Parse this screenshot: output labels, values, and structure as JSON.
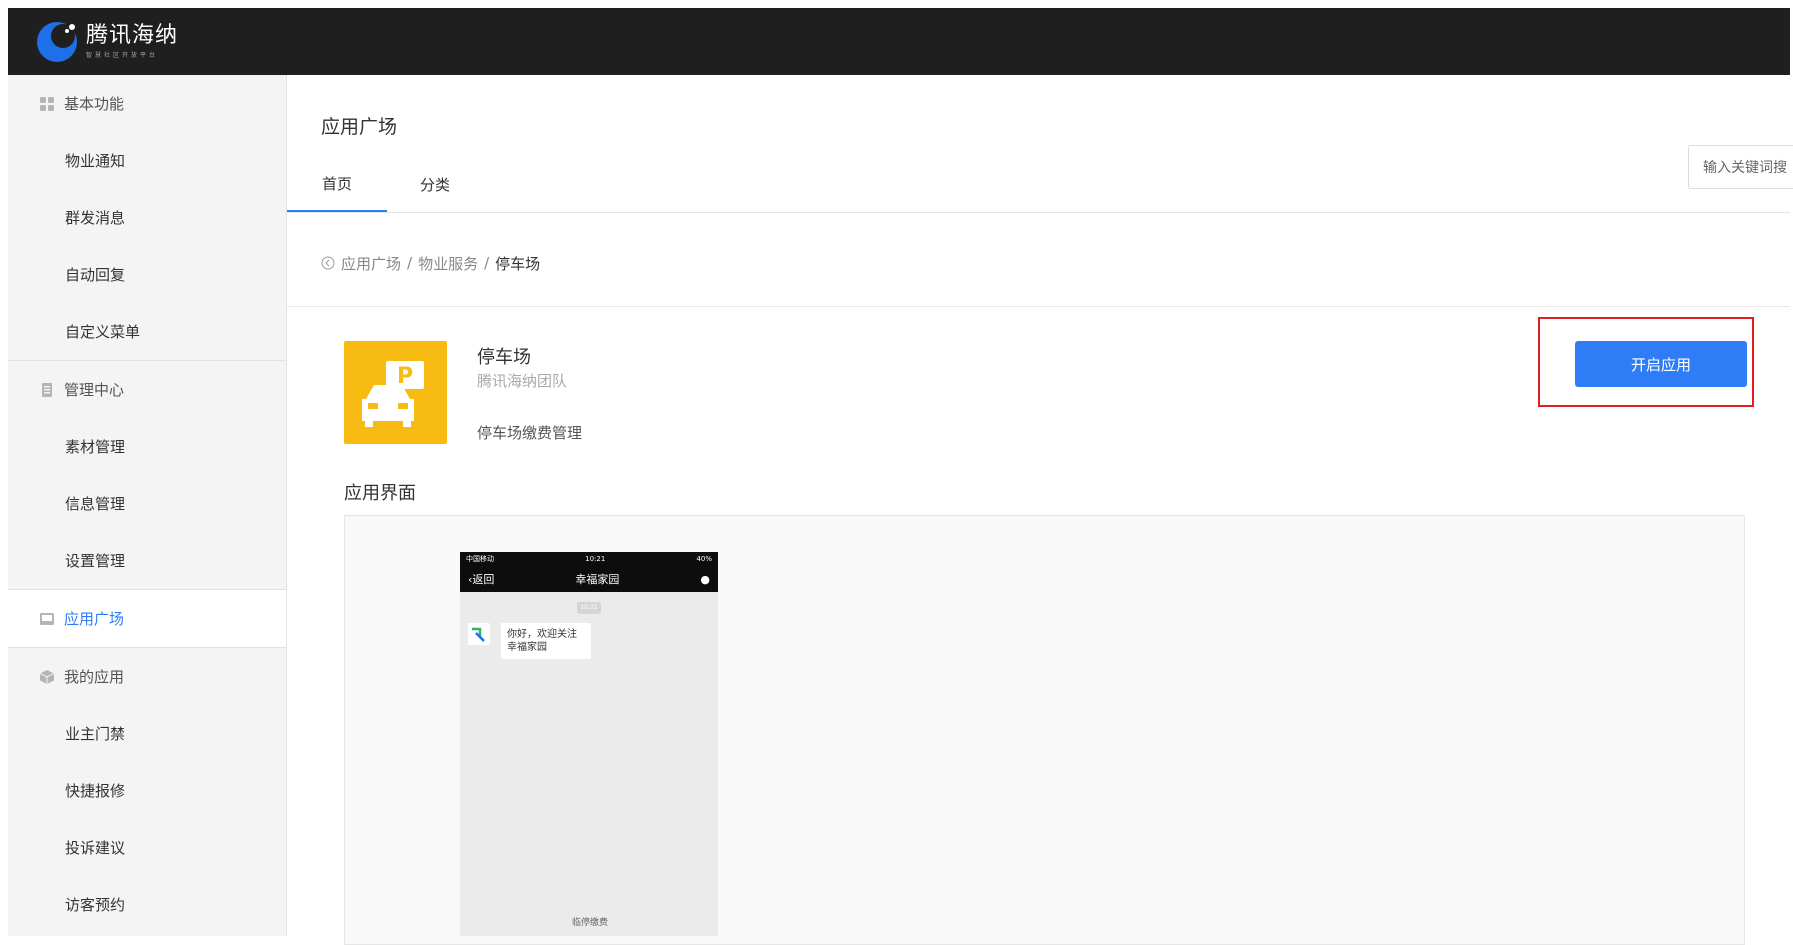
{
  "brand": {
    "name": "腾讯海纳",
    "tagline": "智慧社区开放平台"
  },
  "sidebar": {
    "groups": [
      {
        "title": "基本功能",
        "icon": "grid-icon",
        "items": [
          "物业通知",
          "群发消息",
          "自动回复",
          "自定义菜单"
        ]
      },
      {
        "title": "管理中心",
        "icon": "document-icon",
        "items": [
          "素材管理",
          "信息管理",
          "设置管理"
        ]
      },
      {
        "title": "应用广场",
        "icon": "app-store-icon",
        "active": true,
        "items": []
      },
      {
        "title": "我的应用",
        "icon": "cube-icon",
        "items": [
          "业主门禁",
          "快捷报修",
          "投诉建议",
          "访客预约"
        ]
      }
    ]
  },
  "main": {
    "title": "应用广场",
    "tabs": [
      "首页",
      "分类"
    ],
    "search_placeholder": "输入关键词搜",
    "breadcrumb": {
      "items": [
        "应用广场",
        "物业服务"
      ],
      "current": "停车场"
    },
    "app": {
      "name": "停车场",
      "developer": "腾讯海纳团队",
      "description": "停车场缴费管理",
      "open_button": "开启应用"
    },
    "screens_title": "应用界面",
    "phone": {
      "carrier": "中国移动",
      "time": "10:21",
      "battery": "40%",
      "back": "返回",
      "chat_title": "幸福家园",
      "msg_time": "10:21",
      "message": "你好，欢迎关注幸福家园",
      "bottom_text": "临停缴费"
    }
  },
  "colors": {
    "accent": "#2f7df6",
    "app_icon_bg": "#f8bb14",
    "highlight": "#e02020",
    "topbar": "#1f1f1f"
  }
}
